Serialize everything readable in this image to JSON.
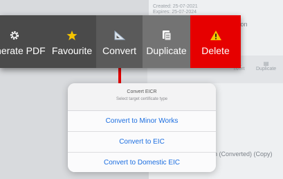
{
  "background": {
    "cert_lines": [
      "Created: 25-07-2021",
      "Expires: 25-07-2024"
    ],
    "version_text": "rsion",
    "mini_actions": [
      "nvert",
      "Duplicate"
    ],
    "converted_text": "n (Converted) (Copy)"
  },
  "action_bar": {
    "items": [
      {
        "label": "Generate PDF",
        "icon": "gear-icon"
      },
      {
        "label": "Favourite",
        "icon": "star-icon"
      },
      {
        "label": "Convert",
        "icon": "ruler-triangle-icon"
      },
      {
        "label": "Duplicate",
        "icon": "copy-document-icon"
      },
      {
        "label": "Delete",
        "icon": "warning-icon"
      }
    ],
    "colors": {
      "bar": "#404040",
      "delete": "#e60000",
      "star": "#f5c400",
      "warning": "#f5c400"
    }
  },
  "sheet": {
    "title": "Convert EICR",
    "subtitle": "Select target certificate type",
    "options": [
      "Convert to Minor Works",
      "Convert to EIC",
      "Convert to Domestic EIC"
    ],
    "accent": "#1a6de0"
  }
}
